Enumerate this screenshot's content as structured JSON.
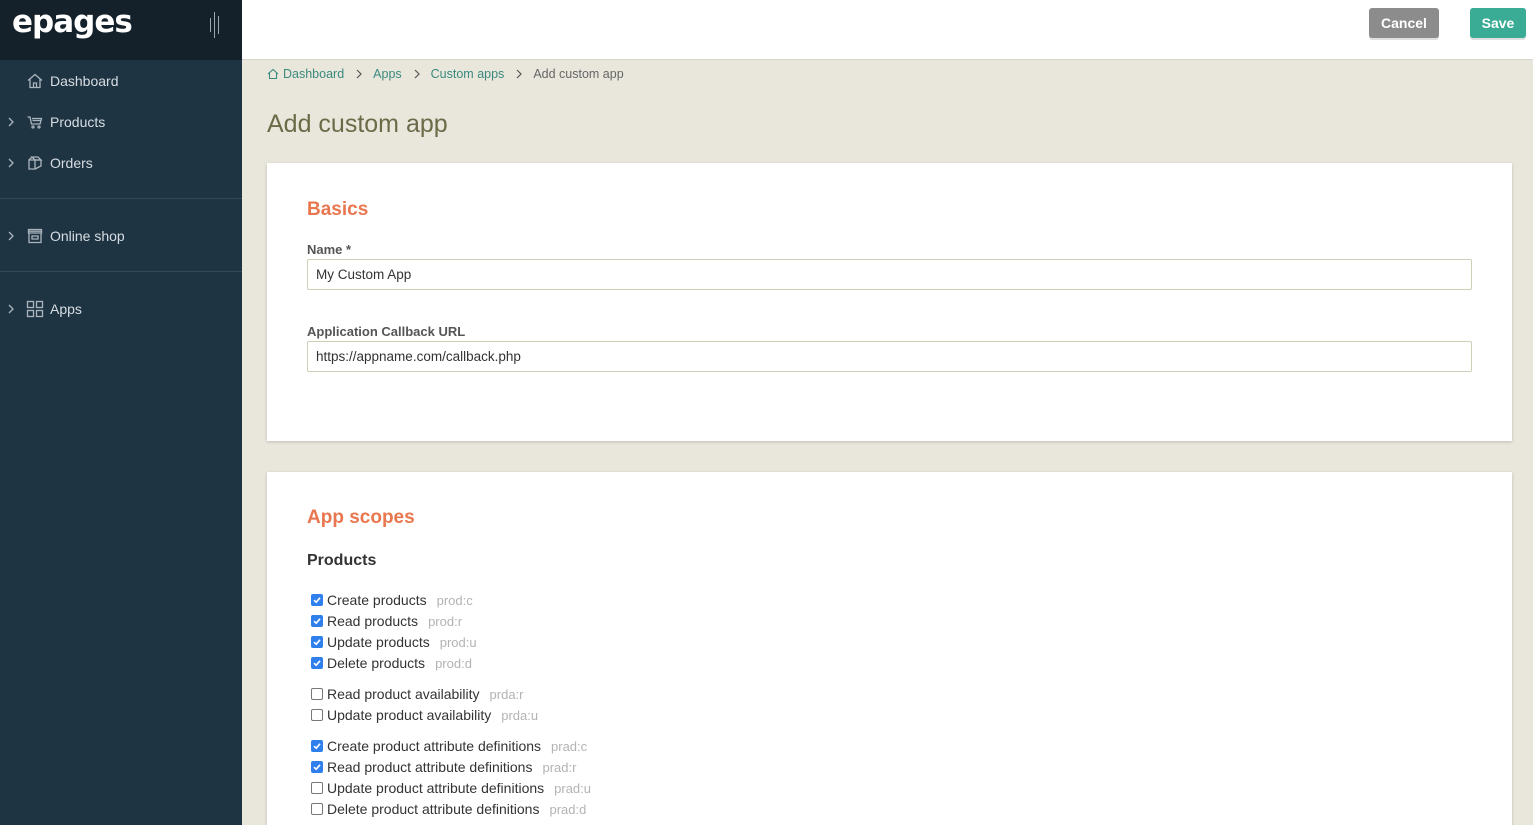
{
  "sidebar": {
    "logo": "epages",
    "items": [
      {
        "label": "Dashboard"
      },
      {
        "label": "Products"
      },
      {
        "label": "Orders"
      },
      {
        "label": "Online shop"
      },
      {
        "label": "Apps"
      }
    ]
  },
  "toolbar": {
    "cancel_label": "Cancel",
    "save_label": "Save"
  },
  "breadcrumb": {
    "items": [
      "Dashboard",
      "Apps",
      "Custom apps"
    ],
    "current": "Add custom app"
  },
  "page": {
    "title": "Add custom app"
  },
  "basics": {
    "title": "Basics",
    "name_label": "Name *",
    "name_value": "My Custom App",
    "callback_label": "Application Callback URL",
    "callback_value": "https://appname.com/callback.php"
  },
  "scopes": {
    "title": "App scopes",
    "products_heading": "Products",
    "items": [
      {
        "label": "Create products",
        "code": "prod:c",
        "checked": true
      },
      {
        "label": "Read products",
        "code": "prod:r",
        "checked": true
      },
      {
        "label": "Update products",
        "code": "prod:u",
        "checked": true
      },
      {
        "label": "Delete products",
        "code": "prod:d",
        "checked": true
      },
      {
        "label": "Read product availability",
        "code": "prda:r",
        "checked": false
      },
      {
        "label": "Update product availability",
        "code": "prda:u",
        "checked": false
      },
      {
        "label": "Create product attribute definitions",
        "code": "prad:c",
        "checked": true
      },
      {
        "label": "Read product attribute definitions",
        "code": "prad:r",
        "checked": true
      },
      {
        "label": "Update product attribute definitions",
        "code": "prad:u",
        "checked": false
      },
      {
        "label": "Delete product attribute definitions",
        "code": "prad:d",
        "checked": false
      }
    ]
  },
  "colors": {
    "sidebar_bg": "#1f3443",
    "accent_orange": "#e8774f",
    "save_green": "#3aab94",
    "link_teal": "#3a8a7e",
    "checkbox_blue": "#2f80ed"
  },
  "icons": {
    "dashboard": "home-icon",
    "products": "cart-icon",
    "orders": "boxes-icon",
    "online_shop": "store-icon",
    "apps": "grid-icon"
  }
}
